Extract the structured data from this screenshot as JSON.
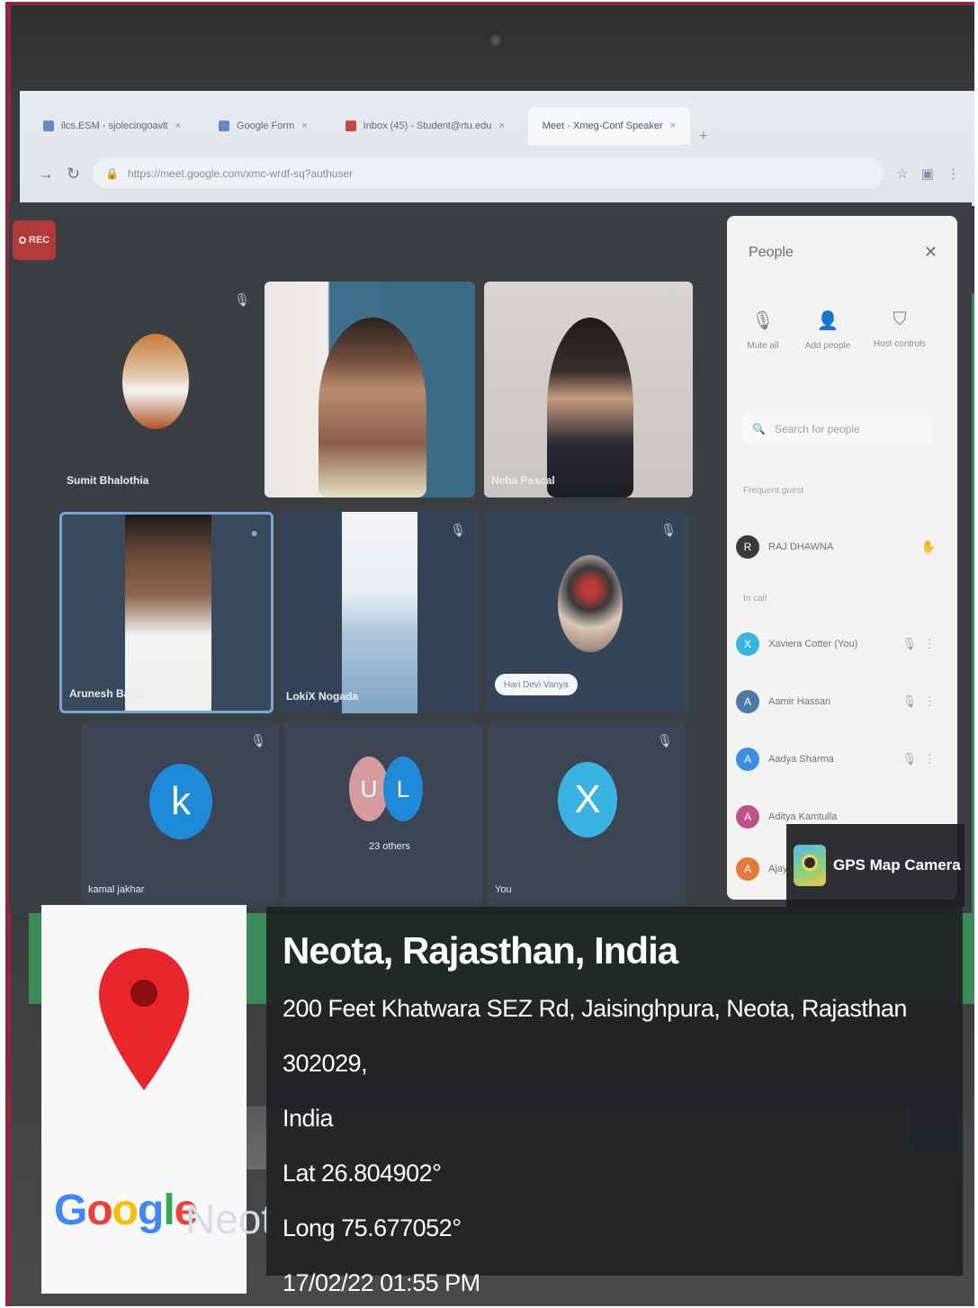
{
  "browser": {
    "tabs": [
      {
        "label": "ilcs.ESM - sjolecingoavlt",
        "icon": "docs-icon",
        "active": false
      },
      {
        "label": "Google Form",
        "icon": "forms-icon",
        "active": false
      },
      {
        "label": "Inbox (45) - Student@rtu.edu",
        "icon": "gmail-icon",
        "active": false
      },
      {
        "label": "Meet - Xmeg-Conf Speaker",
        "icon": "meet-icon",
        "active": true
      }
    ],
    "url": "https://meet.google.com/xmc-wrdf-sq?authuser"
  },
  "meet": {
    "rec_label": "REC",
    "tiles": [
      {
        "name": "Sumit Bhalothia"
      },
      {
        "name": ""
      },
      {
        "name": "Neha Pascal"
      },
      {
        "name": "Arunesh Babu"
      },
      {
        "name": "LokiX Nogada"
      },
      {
        "name": "",
        "pill": "Hari Devi Vanya"
      },
      {
        "name": "kamal jakhar",
        "letter": "k"
      },
      {
        "name": "23 others",
        "letters": [
          "U",
          "L"
        ]
      },
      {
        "name": "You",
        "letter": "X"
      }
    ]
  },
  "people": {
    "title": "People",
    "actions": [
      "Mute all",
      "Add people",
      "Host controls"
    ],
    "search_placeholder": "Search for people",
    "pinned_label": "Frequent guest",
    "in_call_label": "In call",
    "participants": [
      {
        "name": "RAJ DHAWNA",
        "initial": "R",
        "color": "#3a3a3a"
      },
      {
        "name": "Xaviera Cotter  (You)",
        "initial": "X",
        "color": "#3ab2e2"
      },
      {
        "name": "Aamir Hassan",
        "initial": "A",
        "color": "#4b7aa8"
      },
      {
        "name": "Aadya Sharma",
        "initial": "A",
        "color": "#3a8fe0"
      },
      {
        "name": "Aditya Kamtulla",
        "initial": "A",
        "color": "#c0508a"
      },
      {
        "name": "Ajay",
        "initial": "A",
        "color": "#e07a3a"
      }
    ]
  },
  "gps_badge": {
    "label": "GPS Map Camera"
  },
  "map_card": {
    "watermark": "Neot",
    "logo": [
      "G",
      "o",
      "o",
      "g",
      "l",
      "e"
    ]
  },
  "location": {
    "title": "Neota, Rajasthan, India",
    "address_line1": "200 Feet Khatwara SEZ Rd, Jaisinghpura, Neota, Rajasthan 302029,",
    "address_line2": "India",
    "lat": "Lat 26.804902°",
    "long": "Long 75.677052°",
    "datetime": "17/02/22 01:55 PM"
  },
  "colors": {
    "frame": "#8a2a3a",
    "meet_bg": "#3b3e42",
    "overlay": "#202225",
    "pin": "#e8262c",
    "avatar_blue": "#1f8ad8"
  }
}
